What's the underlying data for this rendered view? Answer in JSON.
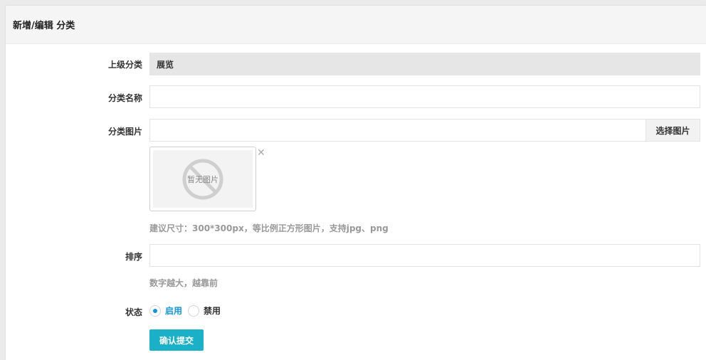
{
  "header": {
    "title": "新增/编辑 分类"
  },
  "form": {
    "parent": {
      "label": "上级分类",
      "value": "展览"
    },
    "name": {
      "label": "分类名称",
      "value": "",
      "placeholder": ""
    },
    "image": {
      "label": "分类图片",
      "value": "",
      "button_label": "选择图片",
      "thumb_text": "暂无图片",
      "remove_symbol": "✕",
      "hint": "建议尺寸：300*300px，等比例正方形图片，支持jpg、png"
    },
    "sort": {
      "label": "排序",
      "value": "",
      "hint": "数字越大，越靠前"
    },
    "status": {
      "label": "状态",
      "options": [
        {
          "label": "启用",
          "checked": true
        },
        {
          "label": "禁用",
          "checked": false
        }
      ]
    },
    "submit_label": "确认提交"
  },
  "colors": {
    "accent": "#1296db",
    "button": "#1ab0c8",
    "readonly_bg": "#e6e6e6",
    "hint": "#999999"
  }
}
